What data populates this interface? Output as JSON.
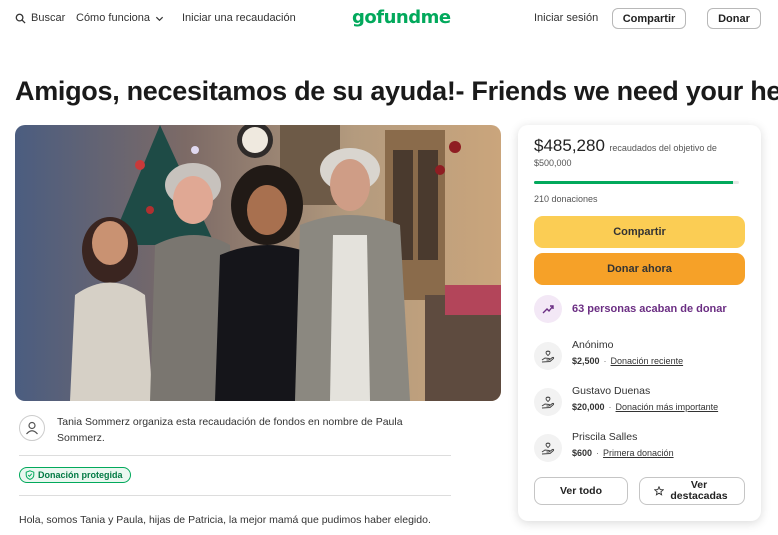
{
  "header": {
    "search_label": "Buscar",
    "how_it_works_label": "Cómo funciona",
    "start_fundraiser_label": "Iniciar una recaudación",
    "logo_text": "gofundme",
    "login_label": "Iniciar sesión",
    "share_label": "Compartir",
    "donate_label": "Donar"
  },
  "campaign": {
    "title": "Amigos, necesitamos de su ayuda!- Friends we need your help!",
    "organizer_text": "Tania Sommerz organiza esta recaudación de fondos en nombre de Paula Sommerz.",
    "protection_badge": "Donación protegida",
    "story_text": "Hola, somos Tania y Paula, hijas de Patricia, la mejor mamá que pudimos haber elegido."
  },
  "card": {
    "raised_amount": "$485,280",
    "raised_text": "recaudados del objetivo de $500,000",
    "progress_fraction": 0.97,
    "donations_count": "210 donaciones",
    "share_button": "Compartir",
    "donate_button": "Donar ahora",
    "recent_activity": "63 personas acaban de donar",
    "donors": [
      {
        "name": "Anónimo",
        "amount": "$2,500",
        "tag": "Donación reciente"
      },
      {
        "name": "Gustavo Duenas",
        "amount": "$20,000",
        "tag": "Donación más importante"
      },
      {
        "name": "Priscila Salles",
        "amount": "$600",
        "tag": "Primera donación"
      }
    ],
    "see_all_button": "Ver todo",
    "see_top_button": "Ver destacadas"
  },
  "colors": {
    "brand_green": "#02a95c",
    "share_yellow": "#fbcd54",
    "donate_orange": "#f6a128",
    "activity_purple": "#6b2e83"
  },
  "icons": [
    "search-icon",
    "chevron-down-icon",
    "user-icon",
    "shield-icon",
    "trending-up-icon",
    "heart-hand-icon",
    "star-icon"
  ]
}
